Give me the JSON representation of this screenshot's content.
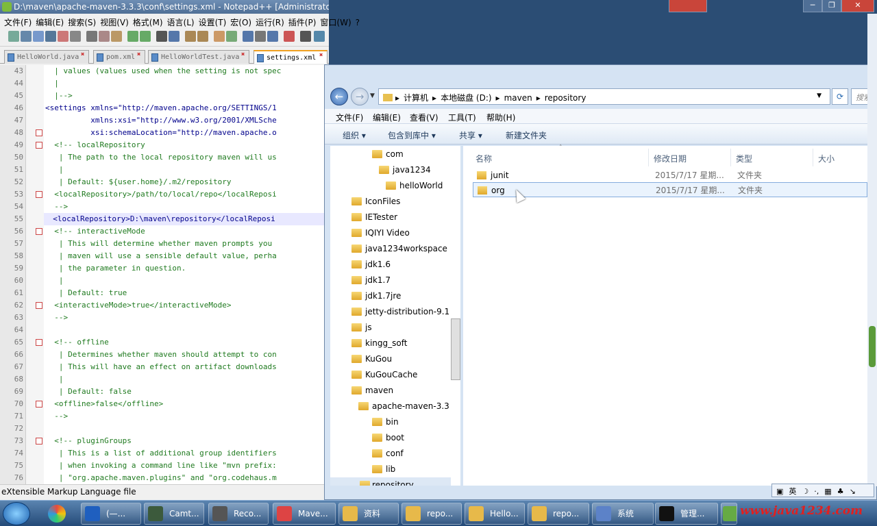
{
  "npp": {
    "title": "D:\\maven\\apache-maven-3.3.3\\conf\\settings.xml - Notepad++ [Administrator]",
    "menu": [
      "文件(F)",
      "编辑(E)",
      "搜索(S)",
      "视图(V)",
      "格式(M)",
      "语言(L)",
      "设置(T)",
      "宏(O)",
      "运行(R)",
      "插件(P)",
      "窗口(W)",
      "?"
    ],
    "tabs": [
      "HelloWorld.java",
      "pom.xml",
      "HelloWorldTest.java",
      "settings.xml"
    ],
    "status": "eXtensible Markup Language file",
    "lines": [
      {
        "n": "43",
        "t": "  | values (values used when the setting is not spec",
        "k": "c"
      },
      {
        "n": "44",
        "t": "  |",
        "k": "c"
      },
      {
        "n": "45",
        "t": "  |-->",
        "k": "c"
      },
      {
        "n": "46",
        "t": "<settings xmlns=\"http://maven.apache.org/SETTINGS/1",
        "k": "t"
      },
      {
        "n": "47",
        "t": "          xmlns:xsi=\"http://www.w3.org/2001/XMLSche",
        "k": "t"
      },
      {
        "n": "48",
        "t": "          xsi:schemaLocation=\"http://maven.apache.o",
        "k": "t"
      },
      {
        "n": "49",
        "t": "  <!-- localRepository",
        "k": "c"
      },
      {
        "n": "50",
        "t": "   | The path to the local repository maven will us",
        "k": "c"
      },
      {
        "n": "51",
        "t": "   |",
        "k": "c"
      },
      {
        "n": "52",
        "t": "   | Default: ${user.home}/.m2/repository",
        "k": "c"
      },
      {
        "n": "53",
        "t": "  <localRepository>/path/to/local/repo</localReposi",
        "k": "c"
      },
      {
        "n": "54",
        "t": "  -->",
        "k": "c"
      },
      {
        "n": "55",
        "t": "  <localRepository>D:\\maven\\repository</localReposi",
        "k": "hl"
      },
      {
        "n": "56",
        "t": "  <!-- interactiveMode",
        "k": "c"
      },
      {
        "n": "57",
        "t": "   | This will determine whether maven prompts you",
        "k": "c"
      },
      {
        "n": "58",
        "t": "   | maven will use a sensible default value, perha",
        "k": "c"
      },
      {
        "n": "59",
        "t": "   | the parameter in question.",
        "k": "c"
      },
      {
        "n": "60",
        "t": "   |",
        "k": "c"
      },
      {
        "n": "61",
        "t": "   | Default: true",
        "k": "c"
      },
      {
        "n": "62",
        "t": "  <interactiveMode>true</interactiveMode>",
        "k": "c"
      },
      {
        "n": "63",
        "t": "  -->",
        "k": "c"
      },
      {
        "n": "64",
        "t": "",
        "k": "c"
      },
      {
        "n": "65",
        "t": "  <!-- offline",
        "k": "c"
      },
      {
        "n": "66",
        "t": "   | Determines whether maven should attempt to con",
        "k": "c"
      },
      {
        "n": "67",
        "t": "   | This will have an effect on artifact downloads",
        "k": "c"
      },
      {
        "n": "68",
        "t": "   |",
        "k": "c"
      },
      {
        "n": "69",
        "t": "   | Default: false",
        "k": "c"
      },
      {
        "n": "70",
        "t": "  <offline>false</offline>",
        "k": "c"
      },
      {
        "n": "71",
        "t": "  -->",
        "k": "c"
      },
      {
        "n": "72",
        "t": "",
        "k": "c"
      },
      {
        "n": "73",
        "t": "  <!-- pluginGroups",
        "k": "c"
      },
      {
        "n": "74",
        "t": "   | This is a list of additional group identifiers",
        "k": "c"
      },
      {
        "n": "75",
        "t": "   | when invoking a command line like \"mvn prefix:",
        "k": "c"
      },
      {
        "n": "76",
        "t": "   | \"org.apache.maven.plugins\" and \"org.codehaus.m",
        "k": "c"
      }
    ]
  },
  "explorer": {
    "breadcrumb": [
      "计算机",
      "本地磁盘 (D:)",
      "maven",
      "repository"
    ],
    "search_placeholder": "搜索",
    "menu": [
      "文件(F)",
      "编辑(E)",
      "查看(V)",
      "工具(T)",
      "帮助(H)"
    ],
    "commands": [
      "组织 ▾",
      "包含到库中 ▾",
      "共享 ▾",
      "新建文件夹"
    ],
    "columns": [
      "名称",
      "修改日期",
      "类型",
      "大小"
    ],
    "tree": [
      {
        "label": "com",
        "indent": 3
      },
      {
        "label": "java1234",
        "indent": 4
      },
      {
        "label": "helloWorld",
        "indent": 5
      },
      {
        "label": "IconFiles",
        "indent": 1
      },
      {
        "label": "IETester",
        "indent": 1
      },
      {
        "label": "IQIYI Video",
        "indent": 1
      },
      {
        "label": "java1234workspace",
        "indent": 1
      },
      {
        "label": "jdk1.6",
        "indent": 1
      },
      {
        "label": "jdk1.7",
        "indent": 1
      },
      {
        "label": "jdk1.7jre",
        "indent": 1
      },
      {
        "label": "jetty-distribution-9.1",
        "indent": 1
      },
      {
        "label": "js",
        "indent": 1
      },
      {
        "label": "kingg_soft",
        "indent": 1
      },
      {
        "label": "KuGou",
        "indent": 1
      },
      {
        "label": "KuGouCache",
        "indent": 1
      },
      {
        "label": "maven",
        "indent": 1
      },
      {
        "label": "apache-maven-3.3",
        "indent": 2
      },
      {
        "label": "bin",
        "indent": 3
      },
      {
        "label": "boot",
        "indent": 3
      },
      {
        "label": "conf",
        "indent": 3
      },
      {
        "label": "lib",
        "indent": 3
      },
      {
        "label": "repository",
        "indent": 2
      }
    ],
    "files": [
      {
        "name": "junit",
        "date": "2015/7/17 星期...",
        "type": "文件夹"
      },
      {
        "name": "org",
        "date": "2015/7/17 星期...",
        "type": "文件夹"
      }
    ]
  },
  "ime": [
    "英",
    "☽",
    "·,",
    "▦",
    "♣",
    "↘"
  ],
  "taskbar": [
    {
      "label": "(—..."
    },
    {
      "label": "Camt..."
    },
    {
      "label": "Reco..."
    },
    {
      "label": "Mave..."
    },
    {
      "label": "资料"
    },
    {
      "label": "repo..."
    },
    {
      "label": "Hello..."
    },
    {
      "label": "repo..."
    },
    {
      "label": "系统"
    },
    {
      "label": "管理..."
    }
  ],
  "watermark": "www.java1234.com"
}
